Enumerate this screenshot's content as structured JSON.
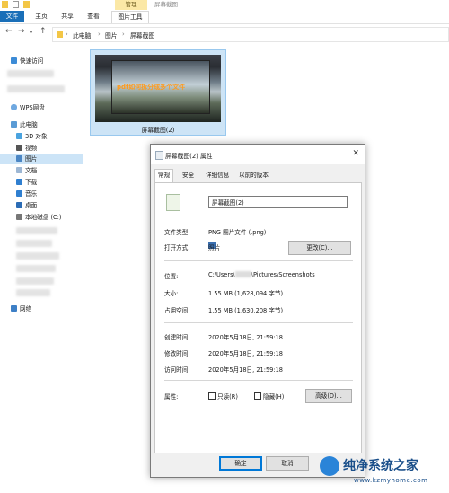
{
  "window": {
    "title": "屏幕截图",
    "context_tab": "管理"
  },
  "ribbon": {
    "tabs": [
      "文件",
      "主页",
      "共享",
      "查看",
      "图片工具"
    ]
  },
  "address": {
    "crumbs": [
      "此电脑",
      "图片",
      "屏幕截图"
    ]
  },
  "sidebar": {
    "items": [
      {
        "label": "快速访问",
        "icon": "star-icon"
      },
      {
        "label": "WPS网盘",
        "icon": "cloud-icon"
      },
      {
        "label": "此电脑",
        "icon": "computer-icon"
      },
      {
        "label": "3D 对象",
        "icon": "cube-icon"
      },
      {
        "label": "视频",
        "icon": "video-icon"
      },
      {
        "label": "图片",
        "icon": "picture-icon"
      },
      {
        "label": "文档",
        "icon": "document-icon"
      },
      {
        "label": "下载",
        "icon": "download-icon"
      },
      {
        "label": "音乐",
        "icon": "music-icon"
      },
      {
        "label": "桌面",
        "icon": "desktop-icon"
      },
      {
        "label": "本地磁盘 (C:)",
        "icon": "drive-icon"
      },
      {
        "label": "网络",
        "icon": "network-icon"
      }
    ]
  },
  "file": {
    "name": "屏幕截图(2)",
    "thumbnail_caption": "pdf如何拆分成多个文件"
  },
  "dialog": {
    "title": "屏幕截图(2) 属性",
    "tabs": [
      "常规",
      "安全",
      "详细信息",
      "以前的版本"
    ],
    "name_value": "屏幕截图(2)",
    "file_type_label": "文件类型:",
    "file_type_value": "PNG 图片文件 (.png)",
    "open_with_label": "打开方式:",
    "open_with_value": "照片",
    "change_button": "更改(C)...",
    "location_label": "位置:",
    "location_prefix": "C:\\Users\\",
    "location_suffix": "\\Pictures\\Screenshots",
    "size_label": "大小:",
    "size_value": "1.55 MB (1,628,094 字节)",
    "disk_size_label": "占用空间:",
    "disk_size_value": "1.55 MB (1,630,208 字节)",
    "created_label": "创建时间:",
    "created_value": "2020年5月18日, 21:59:18",
    "modified_label": "修改时间:",
    "modified_value": "2020年5月18日, 21:59:18",
    "accessed_label": "访问时间:",
    "accessed_value": "2020年5月18日, 21:59:18",
    "attributes_label": "属性:",
    "readonly_label": "只读(R)",
    "hidden_label": "隐藏(H)",
    "advanced_button": "高级(D)...",
    "ok_button": "确定",
    "cancel_button": "取消"
  },
  "watermark": {
    "text": "纯净系统之家",
    "url": "www.kzmyhome.com"
  },
  "colors": {
    "accent": "#1a6fb8",
    "selection": "#cce4f7",
    "manage_tab": "#fbe8a6"
  }
}
